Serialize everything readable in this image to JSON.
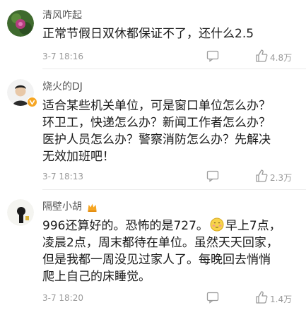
{
  "comments": [
    {
      "username": "清风咋起",
      "lines": [
        "正常节假日双休都保证不了，还什么2.5"
      ],
      "time": "3-7 18:16",
      "likes": "4.8万",
      "badge": "none"
    },
    {
      "username": "烧火的DJ",
      "lines": [
        "适合某些机关单位，可是窗口单位怎么办？",
        "环卫工，快递怎么办？新闻工作者怎么办？",
        "医护人员怎么办？警察消防怎么办？先解决",
        "无效加班吧！"
      ],
      "time": "3-7 18:13",
      "likes": "2.3万",
      "badge": "verified-yellow-v"
    },
    {
      "username": "隔壁小胡",
      "lines": [
        {
          "before": "996还算好的。恐怖的是727。",
          "emoji": "shy-face-emoji",
          "after": "早上7点，"
        },
        "凌晨2点，周末都待在单位。虽然天天回家，",
        "但是我都一周没见过家人了。每晚回去悄悄",
        "爬上自己的床睡觉。"
      ],
      "time": "3-7 18:20",
      "likes": "1.4万",
      "badge": "vip-crown"
    }
  ],
  "colors": {
    "username": "#555555",
    "meta": "#9a9a9a",
    "divider": "#ececec",
    "verified": "#f6a623"
  }
}
